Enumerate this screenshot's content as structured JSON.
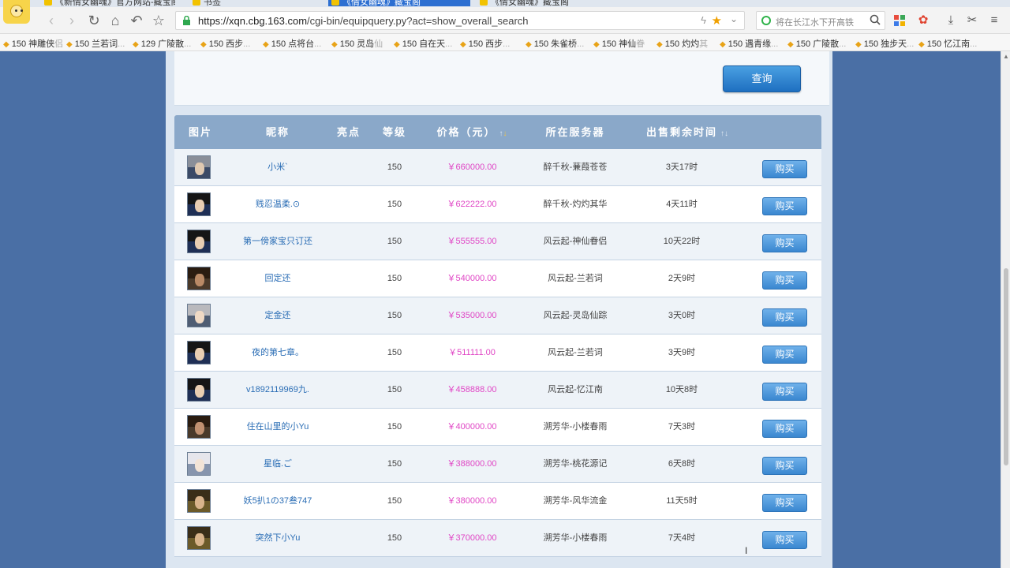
{
  "browser": {
    "tabs": [
      {
        "label": "《新倩女幽魂》官方网站-藏宝阁",
        "active": false
      },
      {
        "label": "书签",
        "active": false
      },
      {
        "label": "《倩女幽魂》藏宝阁",
        "active": true
      },
      {
        "label": "《倩女幽魂》藏宝阁",
        "active": false
      }
    ],
    "url_host": "https://xqn.cbg.163.com",
    "url_path": "/cgi-bin/equipquery.py?act=show_overall_search",
    "search_placeholder": "将在长江水下开高铁",
    "bookmarks": [
      {
        "text": "150 神雕侠",
        "fade": "侣"
      },
      {
        "text": "150 兰若词",
        "fade": "..."
      },
      {
        "text": "129 广陵散",
        "fade": "..."
      },
      {
        "text": "150 西步",
        "fade": "..."
      },
      {
        "text": "150 点将台",
        "fade": "..."
      },
      {
        "text": "150 灵岛",
        "fade": "仙"
      },
      {
        "text": "150 自在天",
        "fade": "..."
      },
      {
        "text": "150 西步",
        "fade": "..."
      },
      {
        "text": "150 朱雀桥",
        "fade": "..."
      },
      {
        "text": "150 神仙",
        "fade": "眷"
      },
      {
        "text": "150 灼灼",
        "fade": "其"
      },
      {
        "text": "150 遇青缘",
        "fade": "..."
      },
      {
        "text": "150 广陵散",
        "fade": "..."
      },
      {
        "text": "150 独步天",
        "fade": "..."
      },
      {
        "text": "150 忆江南",
        "fade": "..."
      }
    ]
  },
  "search_form": {
    "query_label": "查询"
  },
  "table": {
    "headers": {
      "image": "图片",
      "nickname": "昵称",
      "highlight": "亮点",
      "level": "等级",
      "price": "价格（元）",
      "server": "所在服务器",
      "time_left": "出售剩余时间"
    },
    "buy_label": "购买",
    "rows": [
      {
        "nickname": "小米`",
        "level": "150",
        "price": "￥660000.00",
        "server": "醉千秋-蒹葭苍苍",
        "time_left": "3天17时"
      },
      {
        "nickname": "贱忍温柔.⊙",
        "level": "150",
        "price": "￥622222.00",
        "server": "醉千秋-灼灼其华",
        "time_left": "4天11时"
      },
      {
        "nickname": "第一傍家宝只订还",
        "level": "150",
        "price": "￥555555.00",
        "server": "风云起-神仙眷侣",
        "time_left": "10天22时"
      },
      {
        "nickname": "回定还",
        "level": "150",
        "price": "￥540000.00",
        "server": "风云起-兰若词",
        "time_left": "2天9时"
      },
      {
        "nickname": "定金还",
        "level": "150",
        "price": "￥535000.00",
        "server": "风云起-灵岛仙踪",
        "time_left": "3天0时"
      },
      {
        "nickname": "夜的第七章。",
        "level": "150",
        "price": "￥511111.00",
        "server": "风云起-兰若词",
        "time_left": "3天9时"
      },
      {
        "nickname": "v1892119969九.",
        "level": "150",
        "price": "￥458888.00",
        "server": "风云起-忆江南",
        "time_left": "10天8时"
      },
      {
        "nickname": "住在山里的小Yu",
        "level": "150",
        "price": "￥400000.00",
        "server": "溯芳华-小楼春雨",
        "time_left": "7天3时"
      },
      {
        "nickname": "星临.ご",
        "level": "150",
        "price": "￥388000.00",
        "server": "溯芳华-桃花源记",
        "time_left": "6天8时"
      },
      {
        "nickname": "妖5扒1の37叁747",
        "level": "150",
        "price": "￥380000.00",
        "server": "溯芳华-风华流金",
        "time_left": "11天5时"
      },
      {
        "nickname": "突然下小Yu",
        "level": "150",
        "price": "￥370000.00",
        "server": "溯芳华-小楼春雨",
        "time_left": "7天4时"
      }
    ]
  }
}
